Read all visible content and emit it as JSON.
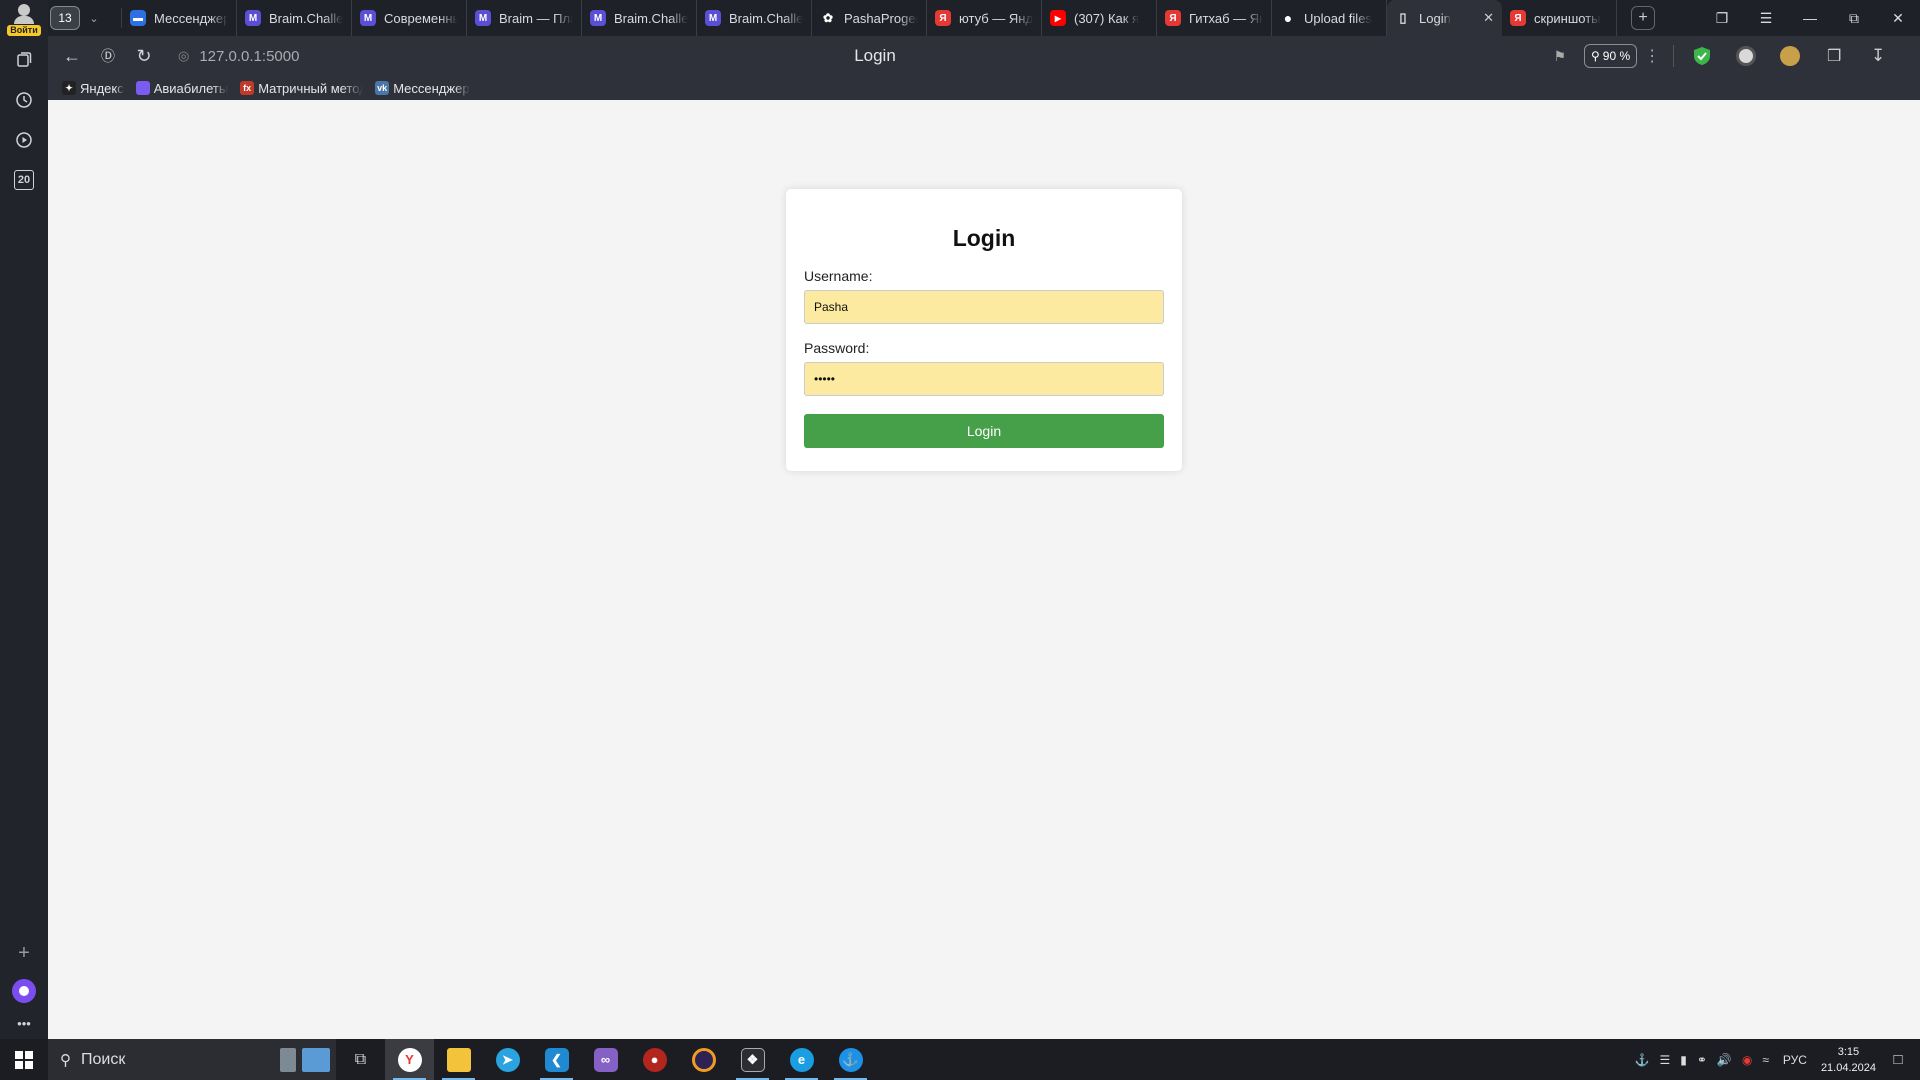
{
  "sidebar": {
    "login_badge": "Войти",
    "date_button": "20"
  },
  "tabstrip": {
    "tab_count": "13",
    "tabs": [
      {
        "title": "Мессенджер",
        "icon": "messenger-icon",
        "color": "#2f6fe4"
      },
      {
        "title": "Braim.Challenge",
        "icon": "braim-icon",
        "color": "#5b4fd6"
      },
      {
        "title": "Современный",
        "icon": "braim-icon",
        "color": "#5b4fd6"
      },
      {
        "title": "Braim — Платформа",
        "icon": "braim-icon",
        "color": "#5b4fd6"
      },
      {
        "title": "Braim.Challenge",
        "icon": "braim-icon",
        "color": "#5b4fd6"
      },
      {
        "title": "Braim.Challenge",
        "icon": "braim-icon",
        "color": "#5b4fd6"
      },
      {
        "title": "PashaProgers",
        "icon": "bunny-icon",
        "color": "#1e2128"
      },
      {
        "title": "ютуб — Яндекс",
        "icon": "yandex-icon",
        "color": "#e53935"
      },
      {
        "title": "(307) Как я",
        "icon": "youtube-icon",
        "color": "#ff0000"
      },
      {
        "title": "Гитхаб — Яндекс",
        "icon": "yandex-icon",
        "color": "#e53935"
      },
      {
        "title": "Upload files",
        "icon": "github-icon",
        "color": "#1e2128"
      },
      {
        "title": "Login",
        "icon": "page-icon",
        "color": "#2e3139",
        "active": true
      },
      {
        "title": "скриншоты",
        "icon": "yandex-icon",
        "color": "#e53935"
      }
    ]
  },
  "toolbar": {
    "url": "127.0.0.1:5000",
    "page_title": "Login",
    "zoom": "90 %"
  },
  "bookmarks": [
    {
      "label": "Яндекс",
      "icon": "yandex-star-icon",
      "color": "#222222"
    },
    {
      "label": "Авиабилеты",
      "icon": "avia-icon",
      "color": "#7a5cf0"
    },
    {
      "label": "Матричный метод",
      "icon": "formula-icon",
      "color": "#c0392b"
    },
    {
      "label": "Мессенджер",
      "icon": "vk-icon",
      "color": "#4a76a8"
    }
  ],
  "login_form": {
    "heading": "Login",
    "username_label": "Username:",
    "username_value": "Pasha",
    "password_label": "Password:",
    "password_value": "•••••",
    "submit_label": "Login"
  },
  "taskbar": {
    "search_placeholder": "Поиск",
    "language": "РУС",
    "time": "3:15",
    "date": "21.04.2024"
  }
}
